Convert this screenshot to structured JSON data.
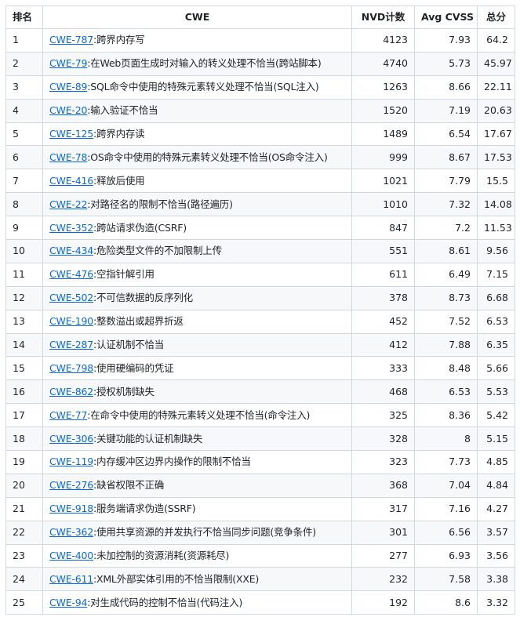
{
  "table": {
    "headers": {
      "rank": "排名",
      "cwe": "CWE",
      "nvd": "NVD计数",
      "cvss": "Avg CVSS",
      "score": "总分"
    },
    "rows": [
      {
        "rank": "1",
        "id": "CWE-787",
        "desc": ":跨界内存写",
        "nvd": "4123",
        "cvss": "7.93",
        "score": "64.2"
      },
      {
        "rank": "2",
        "id": "CWE-79",
        "desc": ":在Web页面生成时对输入的转义处理不恰当(跨站脚本)",
        "nvd": "4740",
        "cvss": "5.73",
        "score": "45.97"
      },
      {
        "rank": "3",
        "id": "CWE-89",
        "desc": ":SQL命令中使用的特殊元素转义处理不恰当(SQL注入)",
        "nvd": "1263",
        "cvss": "8.66",
        "score": "22.11"
      },
      {
        "rank": "4",
        "id": "CWE-20",
        "desc": ":输入验证不恰当",
        "nvd": "1520",
        "cvss": "7.19",
        "score": "20.63"
      },
      {
        "rank": "5",
        "id": "CWE-125",
        "desc": ":跨界内存读",
        "nvd": "1489",
        "cvss": "6.54",
        "score": "17.67"
      },
      {
        "rank": "6",
        "id": "CWE-78",
        "desc": ":OS命令中使用的特殊元素转义处理不恰当(OS命令注入)",
        "nvd": "999",
        "cvss": "8.67",
        "score": "17.53"
      },
      {
        "rank": "7",
        "id": "CWE-416",
        "desc": ":释放后使用",
        "nvd": "1021",
        "cvss": "7.79",
        "score": "15.5"
      },
      {
        "rank": "8",
        "id": "CWE-22",
        "desc": ":对路径名的限制不恰当(路径遍历)",
        "nvd": "1010",
        "cvss": "7.32",
        "score": "14.08"
      },
      {
        "rank": "9",
        "id": "CWE-352",
        "desc": ":跨站请求伪造(CSRF)",
        "nvd": "847",
        "cvss": "7.2",
        "score": "11.53"
      },
      {
        "rank": "10",
        "id": "CWE-434",
        "desc": ":危险类型文件的不加限制上传",
        "nvd": "551",
        "cvss": "8.61",
        "score": "9.56"
      },
      {
        "rank": "11",
        "id": "CWE-476",
        "desc": ":空指针解引用",
        "nvd": "611",
        "cvss": "6.49",
        "score": "7.15"
      },
      {
        "rank": "12",
        "id": "CWE-502",
        "desc": ":不可信数据的反序列化",
        "nvd": "378",
        "cvss": "8.73",
        "score": "6.68"
      },
      {
        "rank": "13",
        "id": "CWE-190",
        "desc": ":整数溢出或超界折返",
        "nvd": "452",
        "cvss": "7.52",
        "score": "6.53"
      },
      {
        "rank": "14",
        "id": "CWE-287",
        "desc": ":认证机制不恰当",
        "nvd": "412",
        "cvss": "7.88",
        "score": "6.35"
      },
      {
        "rank": "15",
        "id": "CWE-798",
        "desc": ":使用硬编码的凭证",
        "nvd": "333",
        "cvss": "8.48",
        "score": "5.66"
      },
      {
        "rank": "16",
        "id": "CWE-862",
        "desc": ":授权机制缺失",
        "nvd": "468",
        "cvss": "6.53",
        "score": "5.53"
      },
      {
        "rank": "17",
        "id": "CWE-77",
        "desc": ":在命令中使用的特殊元素转义处理不恰当(命令注入)",
        "nvd": "325",
        "cvss": "8.36",
        "score": "5.42"
      },
      {
        "rank": "18",
        "id": "CWE-306",
        "desc": ":关键功能的认证机制缺失",
        "nvd": "328",
        "cvss": "8",
        "score": "5.15"
      },
      {
        "rank": "19",
        "id": "CWE-119",
        "desc": ":内存缓冲区边界内操作的限制不恰当",
        "nvd": "323",
        "cvss": "7.73",
        "score": "4.85"
      },
      {
        "rank": "20",
        "id": "CWE-276",
        "desc": ":缺省权限不正确",
        "nvd": "368",
        "cvss": "7.04",
        "score": "4.84"
      },
      {
        "rank": "21",
        "id": "CWE-918",
        "desc": ":服务端请求伪造(SSRF)",
        "nvd": "317",
        "cvss": "7.16",
        "score": "4.27"
      },
      {
        "rank": "22",
        "id": "CWE-362",
        "desc": ":使用共享资源的并发执行不恰当同步问题(竞争条件)",
        "nvd": "301",
        "cvss": "6.56",
        "score": "3.57"
      },
      {
        "rank": "23",
        "id": "CWE-400",
        "desc": ":未加控制的资源消耗(资源耗尽)",
        "nvd": "277",
        "cvss": "6.93",
        "score": "3.56"
      },
      {
        "rank": "24",
        "id": "CWE-611",
        "desc": ":XML外部实体引用的不恰当限制(XXE)",
        "nvd": "232",
        "cvss": "7.58",
        "score": "3.38"
      },
      {
        "rank": "25",
        "id": "CWE-94",
        "desc": ":对生成代码的控制不恰当(代码注入)",
        "nvd": "192",
        "cvss": "8.6",
        "score": "3.32"
      }
    ]
  }
}
